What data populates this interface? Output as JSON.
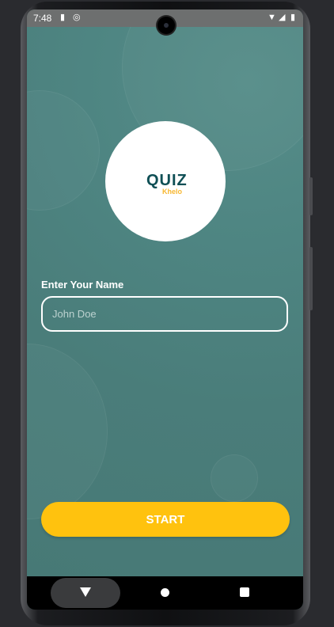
{
  "status_bar": {
    "time": "7:48",
    "icons": [
      "sim-card-icon",
      "vpn-icon",
      "wifi-icon",
      "signal-icon",
      "battery-icon"
    ]
  },
  "logo": {
    "title": "QUIZ",
    "subtitle": "Khelo",
    "colors": {
      "title": "#0f4f55",
      "subtitle": "#f7b731"
    }
  },
  "name_form": {
    "label": "Enter Your Name",
    "placeholder": "John Doe",
    "value": ""
  },
  "start_button": {
    "label": "START",
    "color": "#ffc20e"
  },
  "nav_bar": {
    "icons": [
      "back-icon",
      "home-icon",
      "recents-icon"
    ]
  },
  "theme": {
    "background": "#4a7d7a",
    "status_bar": "#6d6f6f"
  }
}
